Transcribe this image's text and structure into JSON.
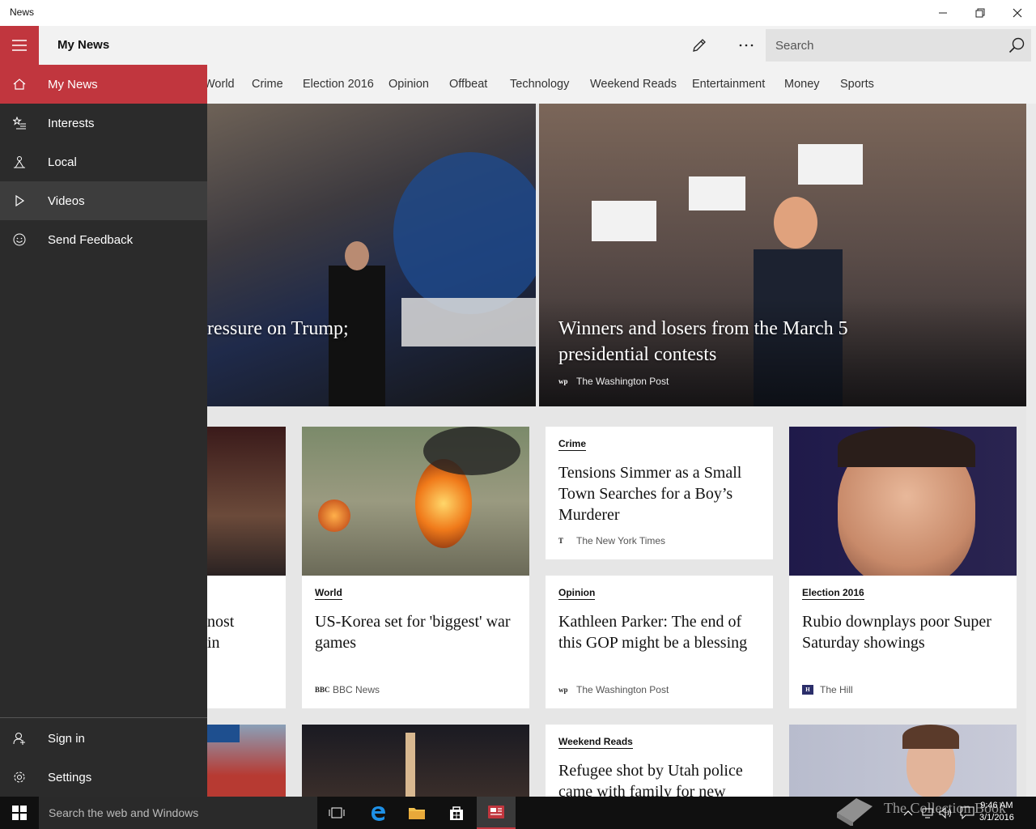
{
  "window": {
    "title": "News"
  },
  "header": {
    "app_title": "My News",
    "search_placeholder": "Search"
  },
  "categories": [
    "World",
    "Crime",
    "Election 2016",
    "Opinion",
    "Offbeat",
    "Technology",
    "Weekend Reads",
    "Entertainment",
    "Money",
    "Sports"
  ],
  "sidebar": {
    "items": [
      {
        "label": "My News",
        "icon": "home-icon",
        "selected": true
      },
      {
        "label": "Interests",
        "icon": "interests-icon"
      },
      {
        "label": "Local",
        "icon": "local-icon"
      },
      {
        "label": "Videos",
        "icon": "play-icon",
        "hover": true
      },
      {
        "label": "Send Feedback",
        "icon": "smiley-icon"
      }
    ],
    "bottom": [
      {
        "label": "Sign in",
        "icon": "person-icon"
      },
      {
        "label": "Settings",
        "icon": "gear-icon"
      }
    ]
  },
  "hero": [
    {
      "headline": "ressure on Trump;",
      "source": ""
    },
    {
      "headline": "Winners and losers from the March 5 presidential contests",
      "source": "The Washington Post"
    }
  ],
  "cards": [
    {
      "tag": "World",
      "headline": "US-Korea set for 'biggest' war games",
      "source": "BBC News"
    },
    {
      "tag": "Crime",
      "headline": "Tensions Simmer as a Small Town Searches for a Boy’s Murderer",
      "source": "The New York Times"
    },
    {
      "tag": "Opinion",
      "headline": "Kathleen Parker: The end of this GOP might be a blessing",
      "source": "The Washington Post"
    },
    {
      "tag": "Election 2016",
      "headline": "Rubio downplays poor Super Saturday showings",
      "source": "The Hill"
    },
    {
      "tag": "Weekend Reads",
      "headline": "Refugee shot by Utah police came with family for new"
    }
  ],
  "partial_card": {
    "line1": "nost",
    "line2": "in"
  },
  "taskbar": {
    "search_placeholder": "Search the web and Windows",
    "time": "9:46 AM",
    "date": "3/1/2016"
  },
  "watermark": "The Collection Book",
  "colors": {
    "accent": "#c1363e",
    "sidebar_bg": "#2b2b2b",
    "taskbar_bg": "#101010"
  }
}
